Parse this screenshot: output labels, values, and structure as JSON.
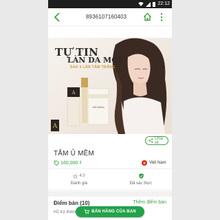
{
  "status_bar": {
    "time": "22:12"
  },
  "header": {
    "title": "8936107160403"
  },
  "promo": {
    "line1": "TỰ TIN",
    "tag": "VỚI",
    "line2": "LÀN DA MỚI",
    "line3": "SAU 3 LẦN TẮM TRẮNG"
  },
  "share": {
    "label": "Chia sẻ"
  },
  "product": {
    "name": "TẮM Ủ MỀM",
    "price": "160,000 ₫",
    "origin": "Việt Nam"
  },
  "stats": {
    "rating_value": "4.0",
    "rating_label": "Đánh giá",
    "verified_label": "Đã xác thực"
  },
  "stores": {
    "title": "Điểm bán (10)",
    "link": "Thêm điểm bán",
    "subtitle": "Hỗ trợ thêm"
  },
  "sell_button": {
    "label": "BÁN HÀNG CỦA BẠN"
  },
  "colors": {
    "accent": "#23a24a",
    "status_bar": "#1e1e1e"
  }
}
